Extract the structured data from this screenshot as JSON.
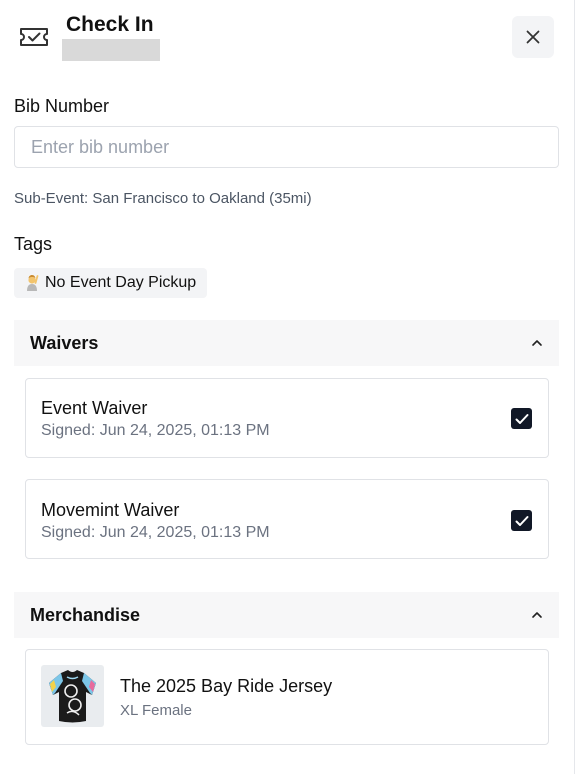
{
  "header": {
    "title": "Check In",
    "icon": "ticket-check-icon",
    "close_icon": "close-icon"
  },
  "bib": {
    "label": "Bib Number",
    "placeholder": "Enter bib number",
    "value": ""
  },
  "sub_event": "Sub-Event: San Francisco to Oakland (35mi)",
  "tags": {
    "label": "Tags",
    "items": [
      {
        "emoji_icon": "woman-raising-hand-icon",
        "label": "No Event Day Pickup"
      }
    ]
  },
  "waivers": {
    "title": "Waivers",
    "items": [
      {
        "title": "Event Waiver",
        "signed": "Signed: Jun 24, 2025, 01:13 PM",
        "checked": true
      },
      {
        "title": "Movemint Waiver",
        "signed": "Signed: Jun 24, 2025, 01:13 PM",
        "checked": true
      }
    ]
  },
  "merchandise": {
    "title": "Merchandise",
    "items": [
      {
        "name": "The 2025 Bay Ride Jersey",
        "variant": "XL Female",
        "image_icon": "jersey-image"
      }
    ]
  },
  "colors": {
    "checkbox": "#111827",
    "section_bg": "#f7f7f8",
    "chip_bg": "#f3f4f6"
  }
}
